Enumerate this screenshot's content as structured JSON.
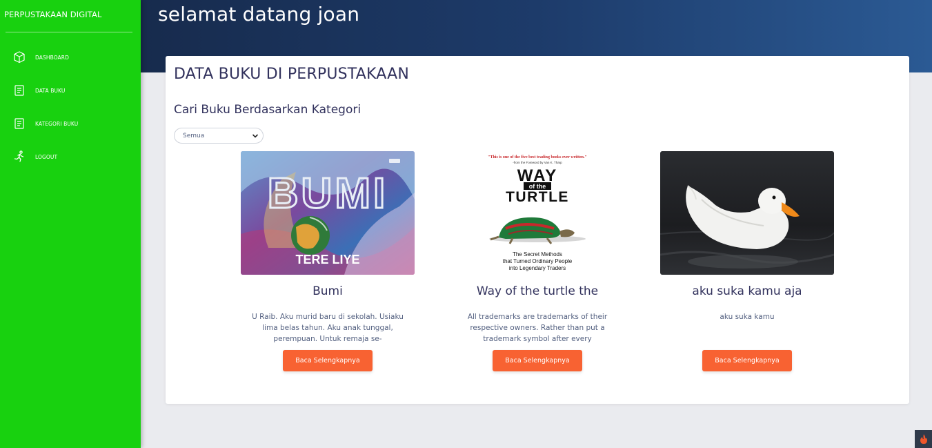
{
  "sidebar": {
    "brand": "PERPUSTAKAAN DIGITAL",
    "items": [
      {
        "label": "DASHBOARD",
        "icon": "box-icon"
      },
      {
        "label": "DATA BUKU",
        "icon": "book-icon"
      },
      {
        "label": "KATEGORI BUKU",
        "icon": "book-icon"
      },
      {
        "label": "LOGOUT",
        "icon": "running-person-icon"
      }
    ]
  },
  "header": {
    "welcome": "selamat datang joan"
  },
  "main": {
    "title": "DATA BUKU DI PERPUSTAKAAN",
    "filter_title": "Cari Buku Berdasarkan Kategori",
    "filter_selected": "Semua",
    "books": [
      {
        "title": "Bumi",
        "desc": "U Raib. Aku murid baru di sekolah. Usiaku lima belas tahun. Aku anak tunggal, perempuan. Untuk remaja se-",
        "button": "Baca Selengkapnya",
        "cover_title": "BUMI",
        "cover_author": "TERE LIYE"
      },
      {
        "title": "Way of the turtle the",
        "desc": "All trademarks are trademarks of their respective owners. Rather than put a trademark symbol after every",
        "button": "Baca Selengkapnya",
        "cover_quote": "\"This is one of the five best trading books ever written.\"",
        "cover_quote_by": "-from the Foreword by Van K. Tharp",
        "cover_line1": "WAY",
        "cover_line2": "of the",
        "cover_line3": "TURTLE",
        "cover_sub1": "The Secret Methods",
        "cover_sub2": "that Turned Ordinary People",
        "cover_sub3": "into Legendary Traders"
      },
      {
        "title": "aku suka kamu aja",
        "desc": "aku suka kamu",
        "button": "Baca Selengkapnya"
      }
    ]
  },
  "colors": {
    "sidebar": "#18d10f",
    "header_start": "#172b4d",
    "header_end": "#2b5a94",
    "button": "#f86232"
  }
}
